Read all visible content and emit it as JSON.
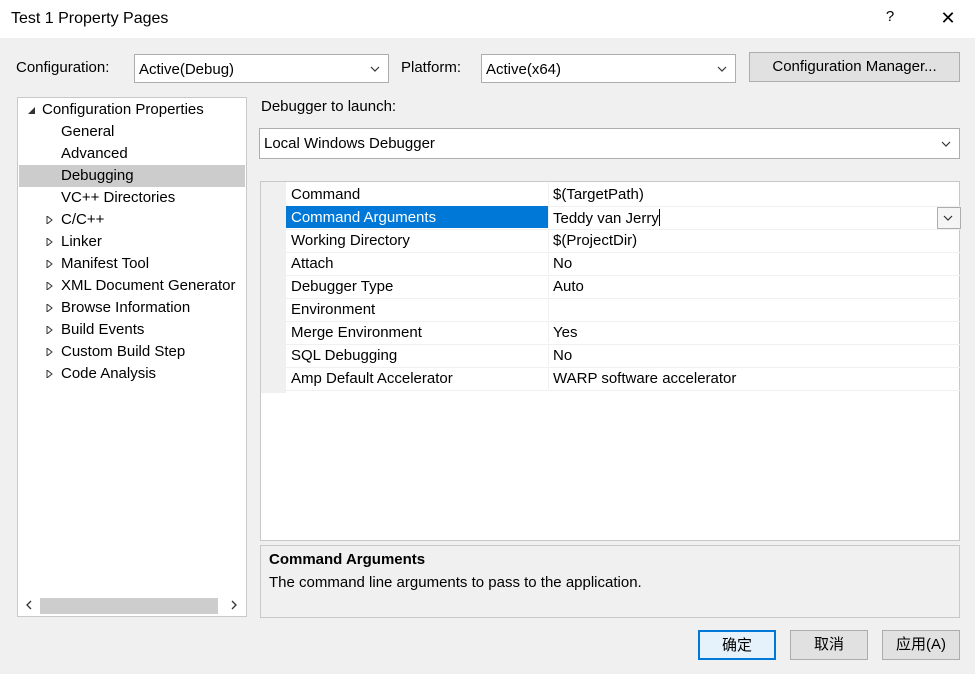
{
  "window": {
    "title": "Test 1 Property Pages",
    "help": "?",
    "close": "✕"
  },
  "top": {
    "configuration_label": "Configuration:",
    "configuration_value": "Active(Debug)",
    "platform_label": "Platform:",
    "platform_value": "Active(x64)",
    "config_manager_button": "Configuration Manager..."
  },
  "tree": {
    "items": [
      {
        "label": "Configuration Properties",
        "expanded": true
      },
      {
        "label": "General"
      },
      {
        "label": "Advanced"
      },
      {
        "label": "Debugging",
        "selected": true
      },
      {
        "label": "VC++ Directories"
      },
      {
        "label": "C/C++",
        "collapsed": true
      },
      {
        "label": "Linker",
        "collapsed": true
      },
      {
        "label": "Manifest Tool",
        "collapsed": true
      },
      {
        "label": "XML Document Generator",
        "collapsed": true
      },
      {
        "label": "Browse Information",
        "collapsed": true
      },
      {
        "label": "Build Events",
        "collapsed": true
      },
      {
        "label": "Custom Build Step",
        "collapsed": true
      },
      {
        "label": "Code Analysis",
        "collapsed": true
      }
    ]
  },
  "debugger": {
    "launch_label": "Debugger to launch:",
    "launch_value": "Local Windows Debugger"
  },
  "properties": [
    {
      "name": "Command",
      "value": "$(TargetPath)"
    },
    {
      "name": "Command Arguments",
      "value": "Teddy van Jerry",
      "selected": true
    },
    {
      "name": "Working Directory",
      "value": "$(ProjectDir)"
    },
    {
      "name": "Attach",
      "value": "No"
    },
    {
      "name": "Debugger Type",
      "value": "Auto"
    },
    {
      "name": "Environment",
      "value": ""
    },
    {
      "name": "Merge Environment",
      "value": "Yes"
    },
    {
      "name": "SQL Debugging",
      "value": "No"
    },
    {
      "name": "Amp Default Accelerator",
      "value": "WARP software accelerator"
    }
  ],
  "description": {
    "title": "Command Arguments",
    "text": "The command line arguments to pass to the application."
  },
  "buttons": {
    "ok": "确定",
    "cancel": "取消",
    "apply": "应用(A)"
  },
  "colors": {
    "selection": "#0078d7",
    "tree_selection": "#cccccc",
    "window_bg": "#f0f0f0"
  }
}
